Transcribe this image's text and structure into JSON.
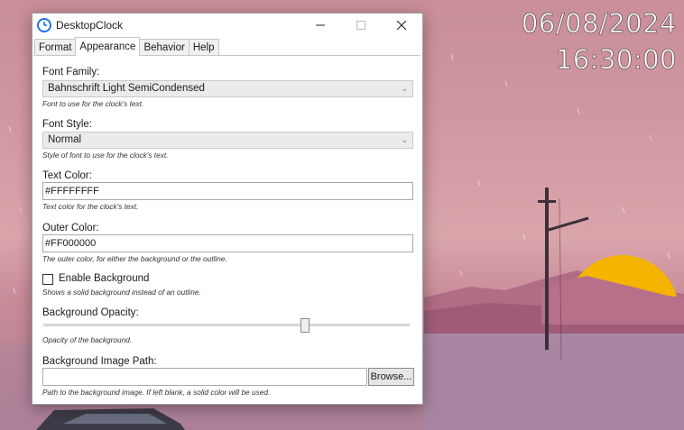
{
  "desktop": {
    "clock_text": "06/08/2024 16:30:00"
  },
  "window": {
    "title": "DesktopClock",
    "icon": "clock-icon",
    "controls": {
      "minimize": "minimize-icon",
      "maximize": "maximize-icon",
      "close": "close-icon"
    }
  },
  "tabs": [
    {
      "label": "Format",
      "active": false
    },
    {
      "label": "Appearance",
      "active": true
    },
    {
      "label": "Behavior",
      "active": false
    },
    {
      "label": "Help",
      "active": false
    }
  ],
  "settings": {
    "font_family": {
      "label": "Font Family:",
      "value": "Bahnschrift Light SemiCondensed",
      "hint": "Font to use for the clock's text."
    },
    "font_style": {
      "label": "Font Style:",
      "value": "Normal",
      "hint": "Style of font to use for the clock's text."
    },
    "text_color": {
      "label": "Text Color:",
      "value": "#FFFFFFFF",
      "hint": "Text color for the clock's text."
    },
    "outer_color": {
      "label": "Outer Color:",
      "value": "#FF000000",
      "hint": "The outer color, for either the background or the outline."
    },
    "enable_background": {
      "label": "Enable Background",
      "checked": false,
      "hint": "Shows a solid background instead of an outline."
    },
    "background_opacity": {
      "label": "Background Opacity:",
      "value_fraction": 0.72,
      "hint": "Opacity of the background."
    },
    "background_image_path": {
      "label": "Background Image Path:",
      "value": "",
      "browse_label": "Browse...",
      "hint": "Path to the background image. If left blank, a solid color will be used."
    }
  },
  "colors": {
    "accent": "#1a73e8",
    "window_bg": "#ffffff",
    "wallpaper_pink": "#cf8e98",
    "sun": "#f5b400"
  }
}
